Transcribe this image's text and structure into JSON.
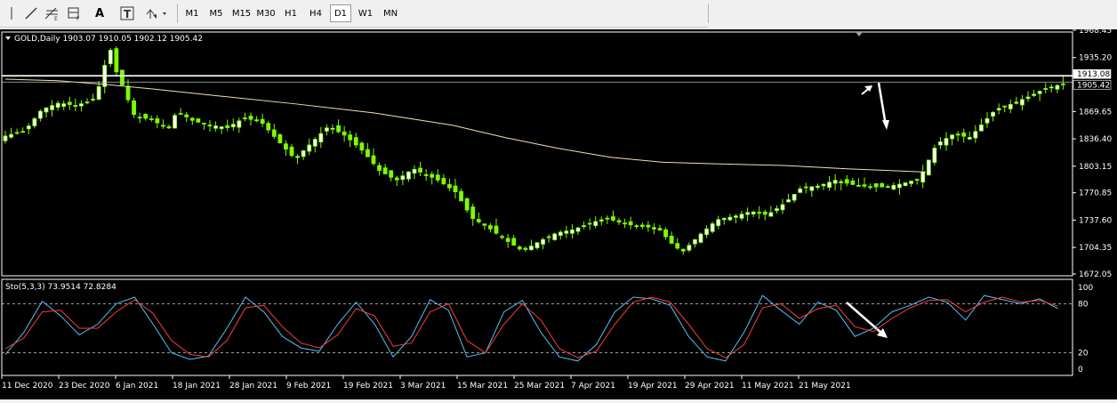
{
  "toolbar": {
    "text_tool_label": "A",
    "timeframes": [
      {
        "label": "M1",
        "active": false
      },
      {
        "label": "M5",
        "active": false
      },
      {
        "label": "M15",
        "active": false
      },
      {
        "label": "M30",
        "active": false
      },
      {
        "label": "H1",
        "active": false
      },
      {
        "label": "H4",
        "active": false
      },
      {
        "label": "D1",
        "active": true
      },
      {
        "label": "W1",
        "active": false
      },
      {
        "label": "MN",
        "active": false
      }
    ],
    "icons": [
      "cursor-icon",
      "line-icon",
      "fibonacci-icon",
      "channel-icon",
      "text-icon",
      "text-label-icon",
      "arrows-icon"
    ]
  },
  "chart_data": [
    {
      "type": "candlestick",
      "info_line": "GOLD,Daily  1903.07 1910.05 1902.12 1905.42",
      "symbol": "GOLD",
      "timeframe": "Daily",
      "ohlc_last": {
        "open": 1903.07,
        "high": 1910.05,
        "low": 1902.12,
        "close": 1905.42
      },
      "ylim": [
        1672.05,
        1968.45
      ],
      "y_ticks": [
        "1968.45",
        "1935.20",
        "1869.65",
        "1836.40",
        "1803.15",
        "1770.85",
        "1737.60",
        "1704.35",
        "1672.05"
      ],
      "price_labels": [
        "1913.08",
        "1905.42"
      ],
      "horizontal_lines": [
        1913.08,
        1905.42
      ],
      "x_ticks": [
        "11 Dec 2020",
        "23 Dec 2020",
        "6 Jan 2021",
        "18 Jan 2021",
        "28 Jan 2021",
        "9 Feb 2021",
        "19 Feb 2021",
        "3 Mar 2021",
        "15 Mar 2021",
        "25 Mar 2021",
        "7 Apr 2021",
        "19 Apr 2021",
        "29 Apr 2021",
        "11 May 2021",
        "21 May 2021"
      ],
      "moving_average_points": [
        [
          0,
          1909
        ],
        [
          10,
          1907
        ],
        [
          20,
          1902
        ],
        [
          28,
          1897
        ],
        [
          40,
          1889
        ],
        [
          55,
          1879
        ],
        [
          70,
          1868
        ],
        [
          85,
          1853
        ],
        [
          95,
          1838
        ],
        [
          105,
          1825
        ],
        [
          115,
          1814
        ],
        [
          125,
          1808
        ],
        [
          135,
          1806
        ],
        [
          148,
          1804
        ],
        [
          160,
          1800
        ],
        [
          175,
          1796
        ]
      ],
      "colors": {
        "background": "#000000",
        "bull": "#7cfc00",
        "bear": "#ffffff",
        "wick": "#7cfc00",
        "ma": "#f5deb3",
        "grid": "#ffffff",
        "axis_text": "#ffffff"
      },
      "annotation_arrows": 2
    },
    {
      "type": "line",
      "info_line": "Sto(5,3,3) 73.9514 72.8284",
      "name": "Sto(5,3,3)",
      "values": {
        "main": 73.9514,
        "signal": 72.8284
      },
      "ylim": [
        0,
        100
      ],
      "y_ticks": [
        "100",
        "80",
        "20",
        "0"
      ],
      "levels": [
        80,
        20
      ],
      "series": [
        {
          "name": "main",
          "color": "#4fc3f7",
          "points": [
            [
              0,
              18
            ],
            [
              4,
              45
            ],
            [
              8,
              83
            ],
            [
              12,
              65
            ],
            [
              16,
              42
            ],
            [
              20,
              55
            ],
            [
              24,
              80
            ],
            [
              28,
              88
            ],
            [
              32,
              55
            ],
            [
              36,
              20
            ],
            [
              40,
              12
            ],
            [
              44,
              16
            ],
            [
              48,
              50
            ],
            [
              52,
              88
            ],
            [
              56,
              70
            ],
            [
              60,
              40
            ],
            [
              64,
              26
            ],
            [
              68,
              22
            ],
            [
              72,
              55
            ],
            [
              76,
              82
            ],
            [
              80,
              55
            ],
            [
              84,
              15
            ],
            [
              88,
              40
            ],
            [
              92,
              85
            ],
            [
              96,
              72
            ],
            [
              100,
              15
            ],
            [
              104,
              20
            ],
            [
              108,
              70
            ],
            [
              112,
              84
            ],
            [
              116,
              45
            ],
            [
              120,
              15
            ],
            [
              124,
              10
            ],
            [
              128,
              30
            ],
            [
              132,
              70
            ],
            [
              136,
              88
            ],
            [
              140,
              86
            ],
            [
              144,
              78
            ],
            [
              148,
              40
            ],
            [
              152,
              15
            ],
            [
              156,
              10
            ],
            [
              160,
              45
            ],
            [
              164,
              90
            ],
            [
              168,
              72
            ],
            [
              172,
              55
            ],
            [
              176,
              82
            ],
            [
              180,
              72
            ],
            [
              184,
              40
            ],
            [
              188,
              50
            ],
            [
              192,
              70
            ],
            [
              196,
              78
            ],
            [
              200,
              88
            ],
            [
              204,
              82
            ],
            [
              208,
              60
            ],
            [
              212,
              90
            ],
            [
              216,
              85
            ],
            [
              220,
              80
            ],
            [
              224,
              86
            ],
            [
              228,
              74
            ]
          ]
        },
        {
          "name": "signal",
          "color": "#ff3b3b",
          "points": [
            [
              0,
              25
            ],
            [
              4,
              38
            ],
            [
              8,
              70
            ],
            [
              12,
              72
            ],
            [
              16,
              50
            ],
            [
              20,
              50
            ],
            [
              24,
              70
            ],
            [
              28,
              85
            ],
            [
              32,
              68
            ],
            [
              36,
              35
            ],
            [
              40,
              18
            ],
            [
              44,
              15
            ],
            [
              48,
              35
            ],
            [
              52,
              75
            ],
            [
              56,
              78
            ],
            [
              60,
              52
            ],
            [
              64,
              32
            ],
            [
              68,
              26
            ],
            [
              72,
              42
            ],
            [
              76,
              74
            ],
            [
              80,
              65
            ],
            [
              84,
              28
            ],
            [
              88,
              32
            ],
            [
              92,
              70
            ],
            [
              96,
              80
            ],
            [
              100,
              35
            ],
            [
              104,
              20
            ],
            [
              108,
              55
            ],
            [
              112,
              80
            ],
            [
              116,
              60
            ],
            [
              120,
              25
            ],
            [
              124,
              14
            ],
            [
              128,
              22
            ],
            [
              132,
              55
            ],
            [
              136,
              82
            ],
            [
              140,
              88
            ],
            [
              144,
              82
            ],
            [
              148,
              55
            ],
            [
              152,
              25
            ],
            [
              156,
              14
            ],
            [
              160,
              30
            ],
            [
              164,
              75
            ],
            [
              168,
              80
            ],
            [
              172,
              62
            ],
            [
              176,
              74
            ],
            [
              180,
              78
            ],
            [
              184,
              52
            ],
            [
              188,
              46
            ],
            [
              192,
              62
            ],
            [
              196,
              75
            ],
            [
              200,
              84
            ],
            [
              204,
              85
            ],
            [
              208,
              70
            ],
            [
              212,
              82
            ],
            [
              216,
              88
            ],
            [
              220,
              82
            ],
            [
              224,
              84
            ],
            [
              228,
              77
            ]
          ]
        }
      ]
    }
  ]
}
